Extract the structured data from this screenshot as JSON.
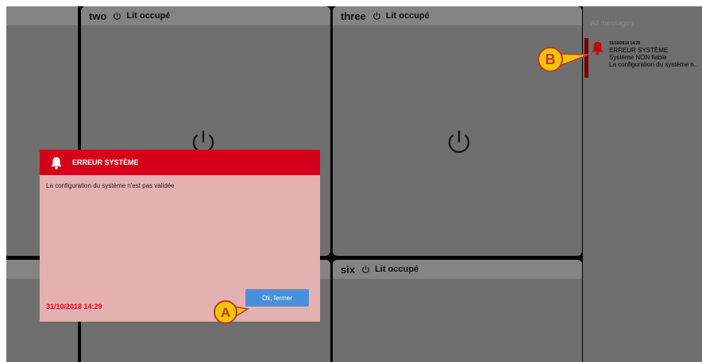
{
  "panels": [
    {
      "name": "",
      "status": ""
    },
    {
      "name": "two",
      "status": "Lit occupé"
    },
    {
      "name": "three",
      "status": "Lit occupé"
    },
    {
      "name": "",
      "status": ""
    },
    {
      "name": "",
      "status": ""
    },
    {
      "name": "six",
      "status": "Lit occupé"
    }
  ],
  "sidebar": {
    "title": "All messages",
    "message": {
      "timestamp": "31/10/2018 14:29",
      "title": "ERREUR SYSTÈME",
      "line1": "Système NON fiable",
      "line2": "La configuration du système n..."
    }
  },
  "dialog": {
    "title": "ERREUR SYSTÈME",
    "body": "La configuration du système n'est pas validée",
    "timestamp": "31/10/2018 14:29",
    "ok_label": "Ok, fermer"
  },
  "callouts": {
    "a": "A",
    "b": "B"
  },
  "colors": {
    "alert_red": "#d4001a",
    "dialog_bg": "#e4b1b1",
    "button_blue": "#4a90d9",
    "callout_yellow": "#f5c400"
  },
  "icons": [
    "power-icon",
    "bell-icon"
  ]
}
